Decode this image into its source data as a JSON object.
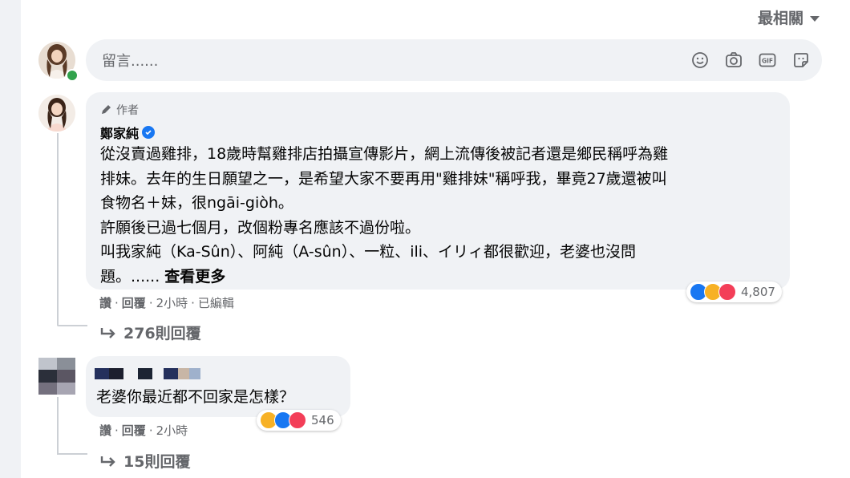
{
  "sort": {
    "label": "最相關"
  },
  "composer": {
    "placeholder": "留言......"
  },
  "comment1": {
    "author_tag": "作者",
    "name": "鄭家純",
    "lines": [
      "從沒賣過雞排，18歲時幫雞排店拍攝宣傳影片，網上流傳後被記者還是鄉民稱呼為雞",
      "排妹。去年的生日願望之一，是希望大家不要再用\"雞排妹\"稱呼我，畢竟27歲還被叫",
      "食物名＋妹，很ngāi-giòh。",
      "許願後已過七個月，改個粉專名應該不過份啦。",
      "叫我家純（Ka-Sûn）、阿純（A-sûn）、一粒、ili、イリィ都很歡迎，老婆也沒問",
      "題。......"
    ],
    "see_more": "查看更多",
    "reactions_count": "4,807",
    "actions": {
      "like": "讚",
      "reply": "回覆",
      "time": "2小時",
      "edited": "已編輯"
    },
    "replies_label": "276則回覆"
  },
  "comment2": {
    "text": "老婆你最近都不回家是怎樣？",
    "reactions_count": "546",
    "actions": {
      "like": "讚",
      "reply": "回覆",
      "time": "2小時"
    },
    "replies_label": "15則回覆"
  },
  "icons": {
    "composer": [
      "emoji-icon",
      "camera-icon",
      "gif-icon",
      "sticker-icon"
    ],
    "reactions1": [
      "like-reaction",
      "haha-reaction",
      "love-reaction"
    ],
    "reactions2": [
      "haha-reaction",
      "like-reaction",
      "love-reaction"
    ]
  },
  "colors": {
    "like": "#1877f2",
    "haha": "#f7b125",
    "love": "#f33e58",
    "online": "#31a24c",
    "bubble": "#f0f2f5",
    "secondary_text": "#65676b"
  }
}
